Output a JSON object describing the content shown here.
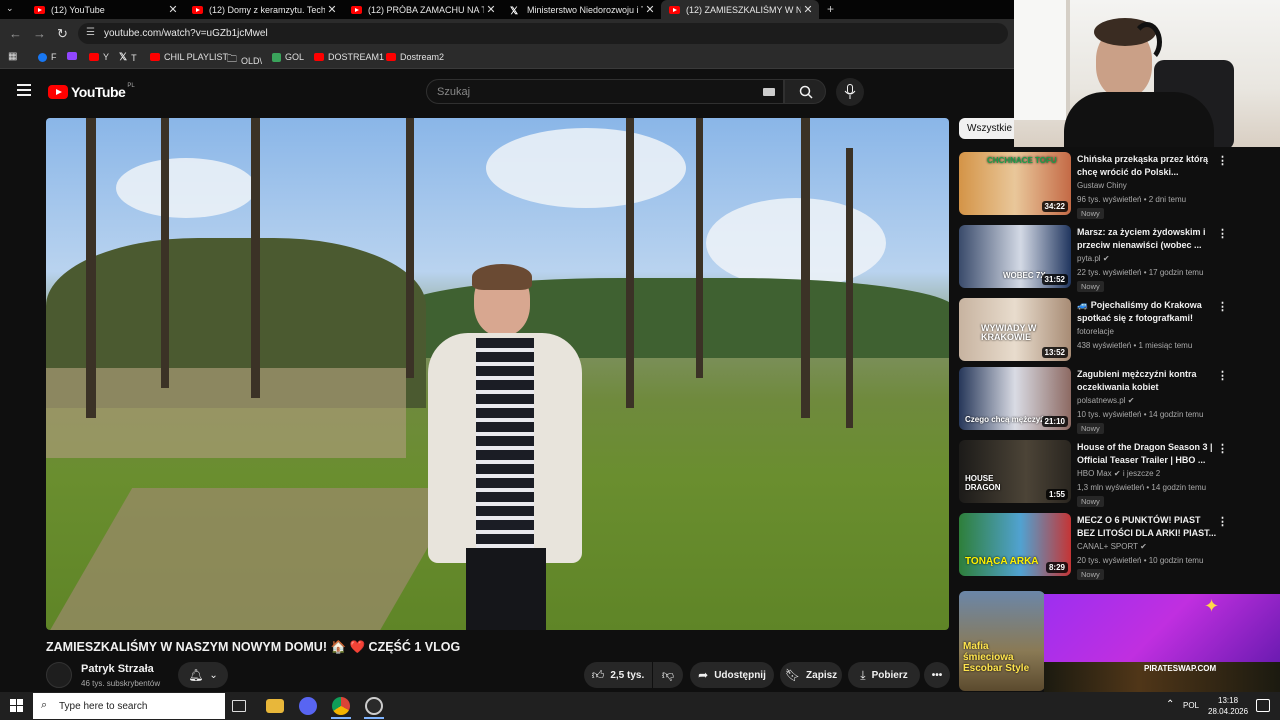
{
  "tabs": [
    {
      "label": "(12) YouTube",
      "type": "yt"
    },
    {
      "label": "(12) Domy z keramzytu. Techno",
      "type": "yt"
    },
    {
      "label": "(12) PRÓBA ZAMACHU NA TRU",
      "type": "yt"
    },
    {
      "label": "Ministerstwo Niedorozwoju i Te",
      "type": "x"
    },
    {
      "label": "(12) ZAMIESZKALIŚMY W NASZ",
      "type": "yt",
      "active": true
    }
  ],
  "new_tab_glyph": "+",
  "address_bar": {
    "url": "youtube.com/watch?v=uGZb1jcMwel"
  },
  "bookmarks": [
    "F",
    "",
    "Y",
    "T",
    "CHIL PLAYLIST",
    "OLD\\",
    "GOL",
    "DOSTREAM1",
    "Dostream2"
  ],
  "youtube": {
    "logo_text": "YouTube",
    "country_code": "PL",
    "search_placeholder": "Szukaj"
  },
  "video": {
    "title": "ZAMIESZKALIŚMY W NASZYM NOWYM DOMU! 🏠 ❤️ CZĘŚĆ 1 VLOG",
    "channel": "Patryk Strzała",
    "subscribers": "46 tys. subskrybentów",
    "likes": "2,5 tys.",
    "share_label": "Udostępnij",
    "save_label": "Zapisz",
    "download_label": "Pobierz"
  },
  "sidebar": {
    "filter_chip": "Wszystkie",
    "recommendations": [
      {
        "title": "Chińska przekąska przez którą chcę wrócić do Polski...",
        "channel": "Gustaw Chiny",
        "meta": "96 tys. wyświetleń • 2 dni temu",
        "badge": "Nowy",
        "duration": "34:22",
        "thumb_text": "CHCHNACE TOFU",
        "thumb_color": "#c9813a"
      },
      {
        "title": "Marsz: za życiem żydowskim i przeciw nienawiści (wobec ...",
        "channel": "pyta.pl",
        "meta": "22 tys. wyświetleń • 17 godzin temu",
        "badge": "Nowy",
        "duration": "31:52",
        "thumb_text": "WOBEC 7X",
        "thumb_color": "#3d5f8c"
      },
      {
        "title": "🚙 Pojechaliśmy do Krakowa spotkać się z fotografkami!",
        "channel": "fotorelacje",
        "meta": "438 wyświetleń • 1 miesiąc temu",
        "badge": "",
        "duration": "13:52",
        "thumb_text": "WYWIADY W KRAKOWIE",
        "thumb_color": "#b7a48e"
      },
      {
        "title": "Zagubieni mężczyźni kontra oczekiwania kobiet",
        "channel": "polsatnews.pl",
        "meta": "10 tys. wyświetleń • 14 godzin temu",
        "badge": "Nowy",
        "duration": "21:10",
        "thumb_text": "Czego chcą mężczyźni",
        "thumb_color": "#5d6d8a"
      },
      {
        "title": "House of the Dragon Season 3 | Official Teaser Trailer | HBO ...",
        "channel": "HBO Max",
        "meta": "1,3 mln wyświetleń • 14 godzin temu",
        "badge": "Nowy",
        "duration": "1:55",
        "thumb_text": "HOUSE DRAGON",
        "thumb_color": "#2a2926",
        "channel_extra": "i jeszcze 2"
      },
      {
        "title": "MECZ O 6 PUNKTÓW! PIAST BEZ LITOŚCI DLA ARKI! PIAST...",
        "channel": "CANAL+ SPORT",
        "meta": "20 tys. wyświetleń • 10 godzin temu",
        "badge": "Nowy",
        "duration": "8:29",
        "thumb_text": "TONĄCA ARKA",
        "thumb_color": "#3a7f3c"
      }
    ],
    "partial_thumb_text": "Mafia śmieciowa Escobar Style"
  },
  "ad_overlay": {
    "text": "PIRATESWAP.COM"
  },
  "taskbar": {
    "search_placeholder": "Type here to search",
    "tray": "POL",
    "time": "13:18",
    "date": "28.04.2026"
  }
}
